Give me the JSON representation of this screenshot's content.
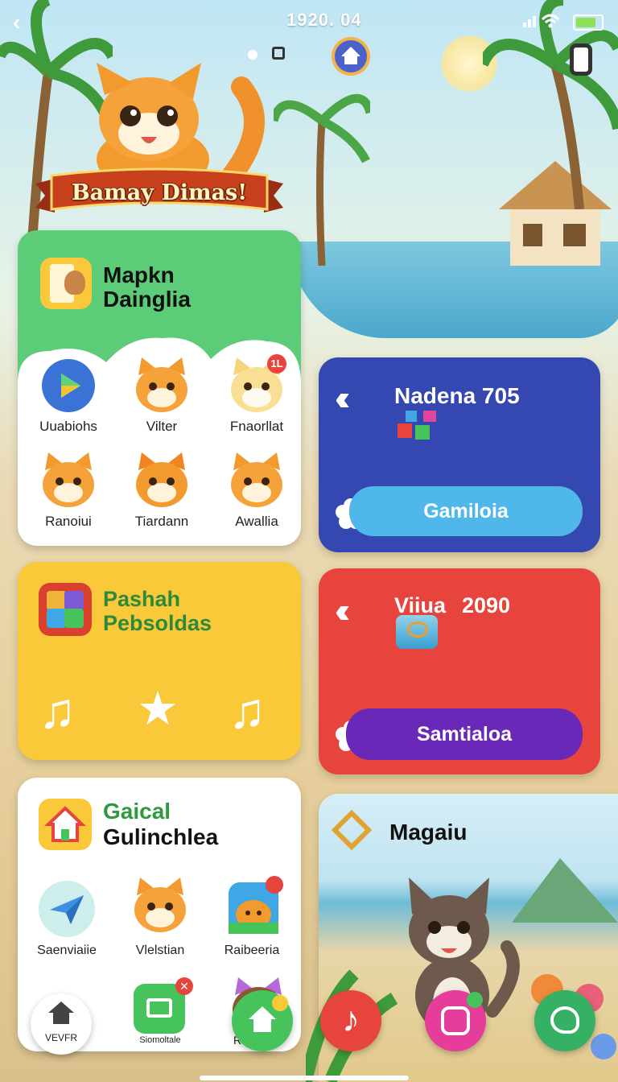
{
  "status": {
    "time": "1920. 04"
  },
  "banner": {
    "title": "Bamay Dimas!"
  },
  "card_green": {
    "title_line1": "Mapkn",
    "title_line2": "Dainglia",
    "apps": [
      {
        "label": "Uuabiohs",
        "icon": "play-store-icon"
      },
      {
        "label": "Vilter",
        "icon": "cat-face-icon"
      },
      {
        "label": "Fnaorllat",
        "icon": "cat-face-icon",
        "badge": "1L"
      },
      {
        "label": "Ranoiui",
        "icon": "cat-face-icon"
      },
      {
        "label": "Tiardann",
        "icon": "cat-face-icon"
      },
      {
        "label": "Awallia",
        "icon": "cat-face-icon"
      }
    ]
  },
  "card_blue": {
    "title": "Nadena 705",
    "button": "Gamiloia"
  },
  "card_yellow": {
    "title_line1": "Pashah",
    "title_line2": "Pebsoldas"
  },
  "card_red": {
    "title": "Viiua",
    "number": "2090",
    "button": "Samtialoa"
  },
  "card_white": {
    "title_line1": "Gaical",
    "title_line2": "Gulinchlea",
    "apps": [
      {
        "label": "Saenviaiie",
        "icon": "paper-plane-icon"
      },
      {
        "label": "Vlelstian",
        "icon": "cat-face-icon"
      },
      {
        "label": "Raibeeria",
        "icon": "cat-app-icon"
      }
    ],
    "bottom_label": "Siomoltale",
    "partial_label": "R"
  },
  "card_photo": {
    "title": "Magaiu"
  },
  "dock": {
    "home_label": "VEVFR"
  },
  "colors": {
    "green": "#5ccc78",
    "blue": "#3547b0",
    "yellow": "#f9c93a",
    "red": "#e8443e",
    "pill_blue": "#4fb7ea",
    "pill_purple": "#6a28b8"
  }
}
